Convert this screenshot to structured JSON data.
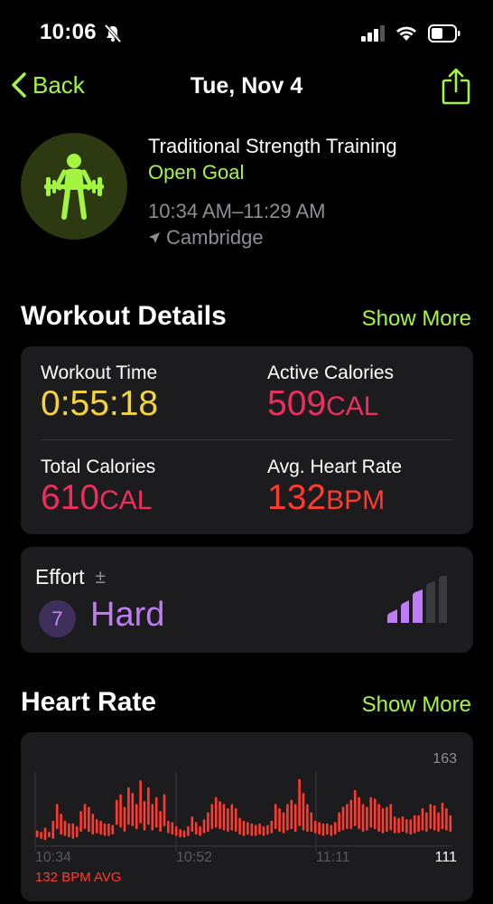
{
  "status_bar": {
    "time": "10:06"
  },
  "nav": {
    "back_label": "Back",
    "title": "Tue, Nov 4"
  },
  "workout": {
    "name": "Traditional Strength Training",
    "goal": "Open Goal",
    "time_range": "10:34 AM–11:29 AM",
    "location": "Cambridge"
  },
  "workout_details": {
    "title": "Workout Details",
    "show_more": "Show More",
    "workout_time": {
      "label": "Workout Time",
      "value": "0:55:18"
    },
    "active_calories": {
      "label": "Active Calories",
      "value": "509",
      "unit": "CAL"
    },
    "total_calories": {
      "label": "Total Calories",
      "value": "610",
      "unit": "CAL"
    },
    "avg_heart_rate": {
      "label": "Avg. Heart Rate",
      "value": "132",
      "unit": "BPM"
    }
  },
  "effort": {
    "label": "Effort",
    "adjust_symbol": "±",
    "level": "7",
    "value": "Hard",
    "bars_total": 5,
    "bars_filled": 3
  },
  "heart_rate": {
    "title": "Heart Rate",
    "show_more": "Show More",
    "avg_label": "132 BPM AVG"
  },
  "colors": {
    "accent": "#a3f542",
    "workout_time": "#f5d33a",
    "calories": "#ee2e5c",
    "heart_rate": "#ff3b30",
    "effort": "#bf7cf5",
    "secondary_text": "#8e8e93",
    "card_bg": "#1c1c1e"
  },
  "chart_data": {
    "type": "bar",
    "title": "",
    "ylim": [
      111,
      163
    ],
    "y_tick_labels": [
      "163",
      "111"
    ],
    "x_tick_labels": [
      "10:34",
      "10:52",
      "11:11"
    ],
    "series": [
      {
        "values": [
          [
            116,
            121
          ],
          [
            115,
            120
          ],
          [
            114,
            123
          ],
          [
            116,
            120
          ],
          [
            115,
            128
          ],
          [
            122,
            140
          ],
          [
            118,
            133
          ],
          [
            117,
            128
          ],
          [
            116,
            126
          ],
          [
            115,
            126
          ],
          [
            116,
            124
          ],
          [
            120,
            135
          ],
          [
            122,
            140
          ],
          [
            120,
            138
          ],
          [
            118,
            133
          ],
          [
            119,
            129
          ],
          [
            118,
            128
          ],
          [
            117,
            126
          ],
          [
            117,
            126
          ],
          [
            118,
            125
          ],
          [
            125,
            143
          ],
          [
            123,
            147
          ],
          [
            120,
            138
          ],
          [
            125,
            152
          ],
          [
            124,
            148
          ],
          [
            122,
            140
          ],
          [
            126,
            157
          ],
          [
            121,
            142
          ],
          [
            125,
            152
          ],
          [
            121,
            140
          ],
          [
            123,
            145
          ],
          [
            120,
            135
          ],
          [
            124,
            147
          ],
          [
            119,
            128
          ],
          [
            118,
            127
          ],
          [
            117,
            124
          ],
          [
            116,
            122
          ],
          [
            116,
            121
          ],
          [
            117,
            124
          ],
          [
            120,
            131
          ],
          [
            118,
            127
          ],
          [
            117,
            124
          ],
          [
            119,
            129
          ],
          [
            120,
            134
          ],
          [
            122,
            140
          ],
          [
            123,
            145
          ],
          [
            122,
            142
          ],
          [
            121,
            140
          ],
          [
            120,
            137
          ],
          [
            121,
            140
          ],
          [
            120,
            137
          ],
          [
            118,
            130
          ],
          [
            117,
            128
          ],
          [
            118,
            127
          ],
          [
            117,
            126
          ],
          [
            117,
            125
          ],
          [
            118,
            126
          ],
          [
            117,
            124
          ],
          [
            118,
            125
          ],
          [
            119,
            128
          ],
          [
            122,
            140
          ],
          [
            120,
            137
          ],
          [
            119,
            134
          ],
          [
            121,
            140
          ],
          [
            122,
            143
          ],
          [
            120,
            140
          ],
          [
            124,
            158
          ],
          [
            121,
            148
          ],
          [
            120,
            140
          ],
          [
            120,
            134
          ],
          [
            119,
            128
          ],
          [
            118,
            127
          ],
          [
            117,
            126
          ],
          [
            118,
            126
          ],
          [
            117,
            125
          ],
          [
            118,
            127
          ],
          [
            120,
            134
          ],
          [
            121,
            138
          ],
          [
            122,
            140
          ],
          [
            122,
            143
          ],
          [
            124,
            150
          ],
          [
            122,
            145
          ],
          [
            120,
            140
          ],
          [
            121,
            138
          ],
          [
            123,
            145
          ],
          [
            122,
            144
          ],
          [
            120,
            140
          ],
          [
            119,
            137
          ],
          [
            120,
            138
          ],
          [
            121,
            140
          ],
          [
            119,
            131
          ],
          [
            119,
            130
          ],
          [
            120,
            131
          ],
          [
            119,
            129
          ],
          [
            118,
            129
          ],
          [
            119,
            132
          ],
          [
            120,
            132
          ],
          [
            121,
            137
          ],
          [
            120,
            134
          ],
          [
            122,
            140
          ],
          [
            121,
            139
          ],
          [
            120,
            134
          ],
          [
            122,
            141
          ],
          [
            121,
            137
          ],
          [
            120,
            132
          ]
        ]
      }
    ]
  }
}
